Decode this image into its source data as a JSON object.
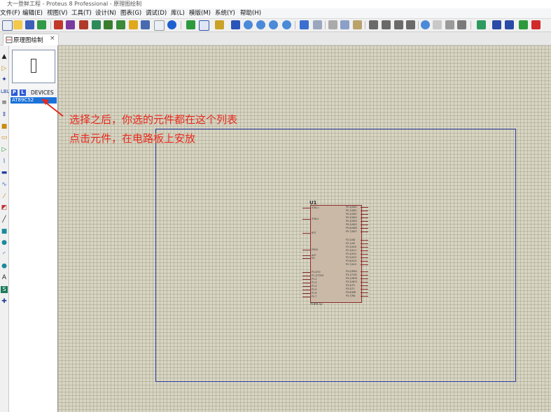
{
  "window": {
    "title": "大一登鲜工程 - Proteus 8 Professional - 原理图绘制"
  },
  "menu": [
    "文件(F)",
    "编辑(E)",
    "视图(V)",
    "工具(T)",
    "设计(N)",
    "图表(G)",
    "调试(D)",
    "库(L)",
    "模版(M)",
    "系统(Y)",
    "帮助(H)"
  ],
  "toolbar_icons": [
    "new-icon",
    "open-icon",
    "save-icon",
    "import-icon",
    "home-icon",
    "component-icon",
    "back-icon",
    "search-icon",
    "bom-icon",
    "gerber-icon",
    "source-icon",
    "pdf-icon",
    "help-icon",
    "refresh-icon",
    "grid-icon",
    "origin-icon",
    "pan-icon",
    "zoom-in-icon",
    "zoom-out-icon",
    "zoom-all-icon",
    "zoom-area-icon",
    "undo-icon",
    "redo-icon",
    "cut-icon",
    "copy-icon",
    "paste-icon",
    "block-copy-icon",
    "block-move-icon",
    "block-rotate-icon",
    "block-delete-icon",
    "pick-device-icon",
    "make-device-icon",
    "packaging-icon",
    "decompose-icon",
    "wire-autorouter-icon",
    "search-tag-icon",
    "property-assign-icon",
    "new-sheet-icon",
    "delete-sheet-icon"
  ],
  "tab": {
    "label": "原理图绘制",
    "close": "×"
  },
  "device_panel": {
    "p_btn": "P",
    "l_btn": "L",
    "header": "DEVICES",
    "items": [
      "AT89C52"
    ]
  },
  "annotation": {
    "line1": "选择之后，你选的元件都在这个列表",
    "line2": "点击元件，在电路板上安放"
  },
  "component": {
    "ref": "U1",
    "part": "AT89C52",
    "left_pins": [
      "XTAL1",
      "XTAL2",
      "RST",
      "PSEN",
      "ALE",
      "EA",
      "P1.0/T2",
      "P1.1/T2EX",
      "P1.2",
      "P1.3",
      "P1.4",
      "P1.5",
      "P1.6",
      "P1.7"
    ],
    "right_pins": [
      "P0.0/AD0",
      "P0.1/AD1",
      "P0.2/AD2",
      "P0.3/AD3",
      "P0.4/AD4",
      "P0.5/AD5",
      "P0.6/AD6",
      "P0.7/AD7",
      "P2.0/A8",
      "P2.1/A9",
      "P2.2/A10",
      "P2.3/A11",
      "P2.4/A12",
      "P2.5/A13",
      "P2.6/A14",
      "P2.7/A15",
      "P3.0/RXD",
      "P3.1/TXD",
      "P3.2/INT0",
      "P3.3/INT1",
      "P3.4/T0",
      "P3.5/T1",
      "P3.6/WR",
      "P3.7/RD"
    ]
  },
  "colors": {
    "sheet_border": "#2b3ca0",
    "canvas": "#d8d5c2",
    "chip_fill": "#c9b9a6",
    "chip_border": "#8a2b2b",
    "annotation": "#e8281c",
    "selection": "#1a72d9"
  }
}
